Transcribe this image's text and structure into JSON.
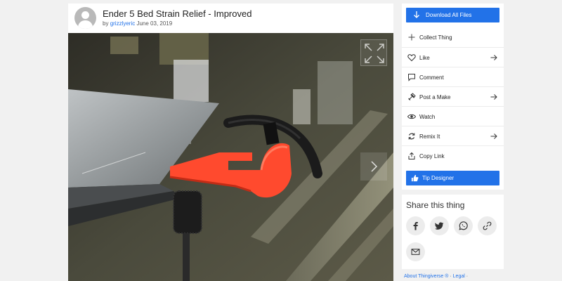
{
  "thing": {
    "title": "Ender 5 Bed Strain Relief - Improved",
    "by_prefix": "by",
    "author": "grizzlyeric",
    "date": "June 03, 2019"
  },
  "icons": {
    "avatar": "user-avatar",
    "expand": "expand-icon",
    "next": "chevron-right-icon"
  },
  "sidebar": {
    "download_label": "Download All Files",
    "items": [
      {
        "label": "Collect Thing",
        "icon": "plus-icon",
        "arrow": false
      },
      {
        "label": "Like",
        "icon": "heart-icon",
        "arrow": true
      },
      {
        "label": "Comment",
        "icon": "comment-icon",
        "arrow": false
      },
      {
        "label": "Post a Make",
        "icon": "tool-icon",
        "arrow": true
      },
      {
        "label": "Watch",
        "icon": "eye-icon",
        "arrow": false
      },
      {
        "label": "Remix It",
        "icon": "remix-icon",
        "arrow": true
      },
      {
        "label": "Copy Link",
        "icon": "share-icon",
        "arrow": false
      }
    ],
    "tip_label": "Tip Designer"
  },
  "share": {
    "title": "Share this thing",
    "buttons": [
      "facebook-icon",
      "twitter-icon",
      "whatsapp-icon",
      "link-icon",
      "email-icon"
    ]
  },
  "footer": {
    "about": "About Thingiverse ®",
    "sep": "·",
    "legal": "Legal",
    "trail": "·"
  },
  "colors": {
    "accent": "#2272e8",
    "background": "#f1f1f1",
    "part": "#ff4a2e"
  }
}
